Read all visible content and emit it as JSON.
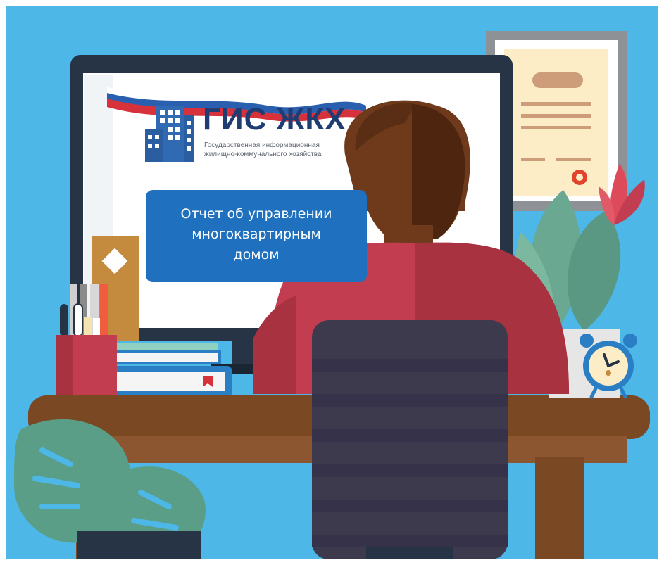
{
  "screen": {
    "logo_title": "ГИС ЖКХ",
    "logo_subtitle_lines": [
      "Государственная информационная",
      "жилищно-коммунального хозяйства"
    ],
    "report_button_lines": [
      "Отчет об управлении",
      "многоквартирным",
      "домом"
    ]
  },
  "colors": {
    "background": "#4db8e8",
    "button": "#1f70be",
    "logo_text": "#1f3d73"
  },
  "icons": [
    "building-icon",
    "flag-ribbon",
    "certificate-frame",
    "alarm-clock-icon",
    "plant-icon",
    "monstera-leaf-icon",
    "books-icon",
    "pen-cup-icon",
    "person-figure",
    "office-chair"
  ]
}
